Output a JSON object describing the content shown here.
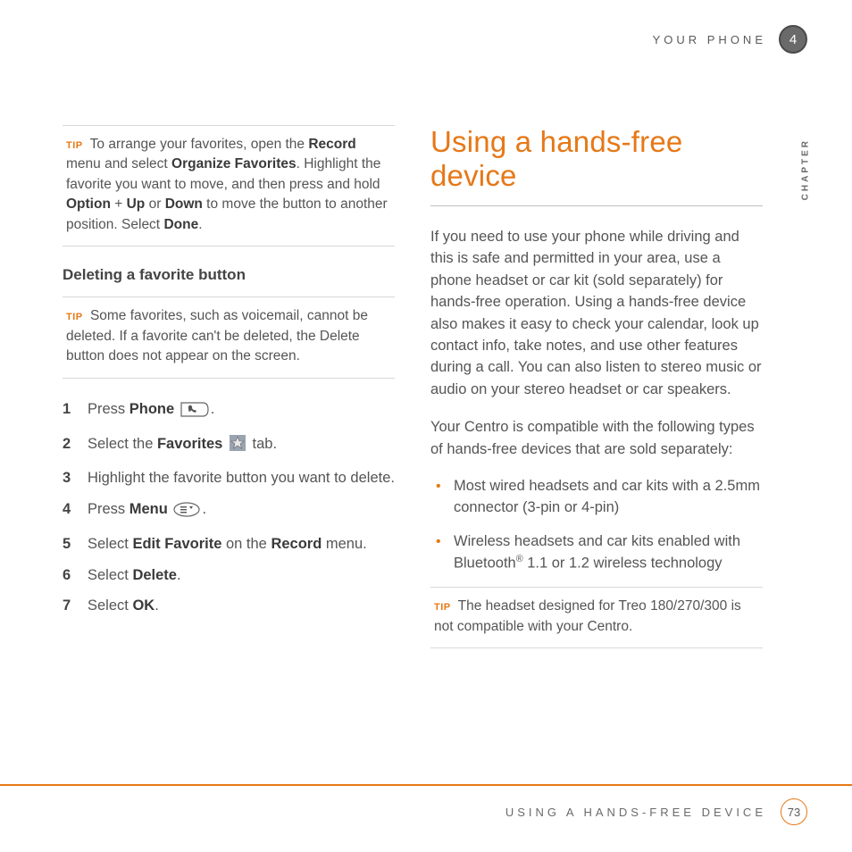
{
  "header": {
    "section": "YOUR PHONE",
    "chapter_num": "4",
    "side_label": "CHAPTER"
  },
  "left": {
    "tip1": {
      "label": "TIP",
      "t1": "To arrange your favorites, open the ",
      "b1": "Record",
      "t2": " menu and select ",
      "b2": "Organize Favorites",
      "t3": ". Highlight the favorite you want to move, and then press and hold ",
      "b3": "Option",
      "t4": " + ",
      "b4": "Up",
      "t5": " or ",
      "b5": "Down",
      "t6": " to move the button to another position. Select ",
      "b6": "Done",
      "t7": "."
    },
    "subhead": "Deleting a favorite button",
    "tip2": {
      "label": "TIP",
      "text": "Some favorites, such as voicemail, cannot be deleted. If a favorite can't be deleted, the Delete button does not appear on the screen."
    },
    "steps": {
      "s1a": "Press ",
      "s1b": "Phone",
      "s1c": ".",
      "s2a": "Select the ",
      "s2b": "Favorites",
      "s2c": " tab.",
      "s3": "Highlight the favorite button you want to delete.",
      "s4a": "Press ",
      "s4b": "Menu",
      "s4c": ".",
      "s5a": "Select ",
      "s5b": "Edit Favorite",
      "s5c": " on the ",
      "s5d": "Record",
      "s5e": " menu.",
      "s6a": "Select ",
      "s6b": "Delete",
      "s6c": ".",
      "s7a": "Select ",
      "s7b": "OK",
      "s7c": "."
    }
  },
  "right": {
    "title": "Using a hands-free device",
    "p1": "If you need to use your phone while driving and this is safe and permitted in your area, use a phone headset or car kit (sold separately) for hands-free operation. Using a hands-free device also makes it easy to check your calendar, look up contact info, take notes, and use other features during a call. You can also listen to stereo music or audio on your stereo headset or car speakers.",
    "p2": "Your Centro is compatible with the following types of hands-free devices that are sold separately:",
    "b1": "Most wired headsets and car kits with a 2.5mm connector (3-pin or 4-pin)",
    "b2a": "Wireless headsets and car kits enabled with Bluetooth",
    "b2b": " 1.1 or 1.2 wireless technology",
    "tip": {
      "label": "TIP",
      "text": "The headset designed for Treo 180/270/300 is not compatible with your Centro."
    }
  },
  "footer": {
    "title": "USING A HANDS-FREE DEVICE",
    "page": "73"
  }
}
